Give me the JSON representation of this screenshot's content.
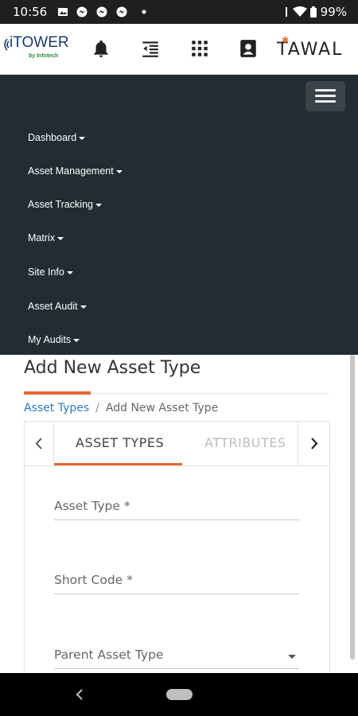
{
  "status_bar": {
    "time": "10:56",
    "battery": "99%",
    "icons": [
      "image-icon",
      "messenger-icon",
      "messenger-icon",
      "messenger-icon",
      "dot-icon",
      "wifi-icon",
      "battery-icon"
    ]
  },
  "header": {
    "logo_itower": "iTOWER",
    "logo_itower_sub": "by Infotech",
    "logo_tawal": "TAWAL",
    "icons": [
      "bell-icon",
      "outdent-icon",
      "apps-grid-icon",
      "contact-card-icon"
    ]
  },
  "nav": {
    "items": [
      {
        "label": "Dashboard"
      },
      {
        "label": "Asset Management"
      },
      {
        "label": "Asset Tracking"
      },
      {
        "label": "Matrix"
      },
      {
        "label": "Site Info"
      },
      {
        "label": "Asset Audit"
      },
      {
        "label": "My Audits"
      }
    ]
  },
  "page": {
    "title": "Add New Asset Type",
    "breadcrumb": {
      "link": "Asset Types",
      "separator": "/",
      "current": "Add New Asset Type"
    }
  },
  "tabs": {
    "items": [
      {
        "label": "ASSET TYPES",
        "active": true
      },
      {
        "label": "ATTRIBUTES",
        "active": false
      }
    ]
  },
  "form": {
    "fields": [
      {
        "label": "Asset Type *"
      },
      {
        "label": "Short Code *"
      },
      {
        "label": "Parent Asset Type"
      }
    ]
  },
  "colors": {
    "accent": "#e8672f",
    "nav_bg": "#212c33",
    "link": "#2f7ab8"
  }
}
